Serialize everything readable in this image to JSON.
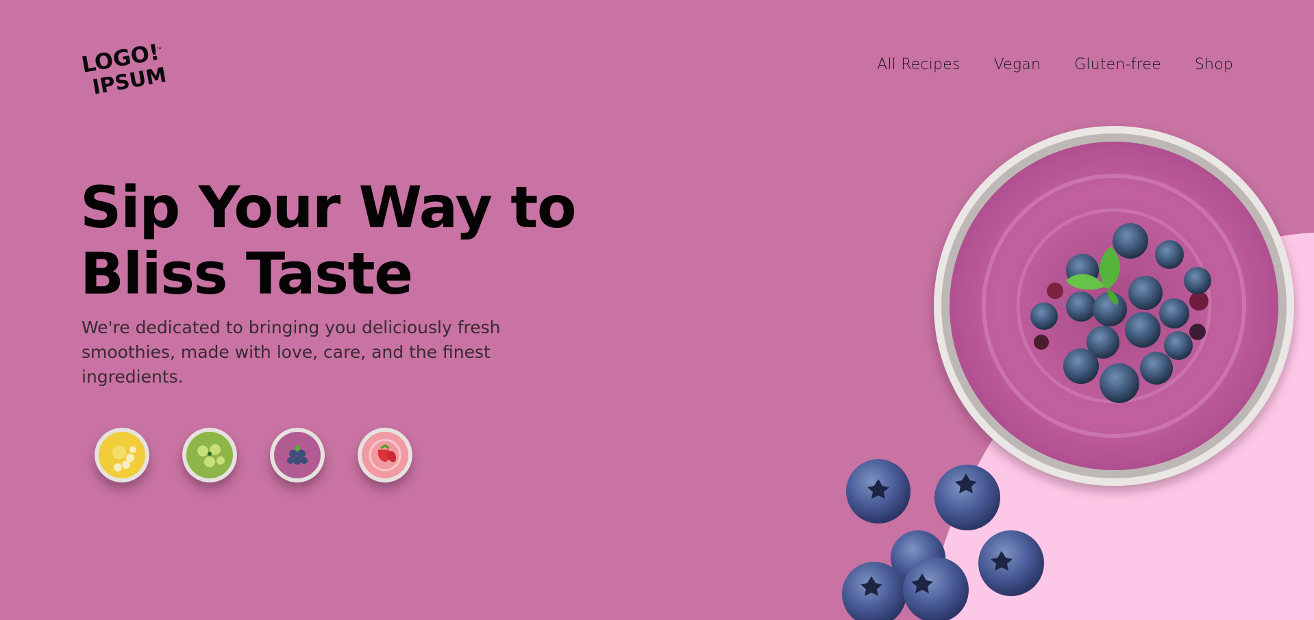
{
  "logo": {
    "line1": "LOGO!",
    "line2": "IPSUM",
    "tm": "™"
  },
  "nav": {
    "items": [
      "All Recipes",
      "Vegan",
      "Gluten-free",
      "Shop"
    ]
  },
  "hero": {
    "title_line1": "Sip Your Way to",
    "title_line2": "Bliss Taste",
    "subtitle_line1": "We're dedicated to bringing you deliciously fresh",
    "subtitle_line2": "smoothies, made with love, care, and the finest",
    "subtitle_line3": "ingredients."
  },
  "flavors": [
    {
      "name": "banana",
      "color": "#f1cd3a"
    },
    {
      "name": "kiwi",
      "color": "#8db548"
    },
    {
      "name": "blueberry",
      "color": "#b25c93"
    },
    {
      "name": "strawberry",
      "color": "#f29aa3"
    }
  ],
  "colors": {
    "background": "#c873a3",
    "accent_shape": "#fdc8e7",
    "text": "#050304"
  }
}
